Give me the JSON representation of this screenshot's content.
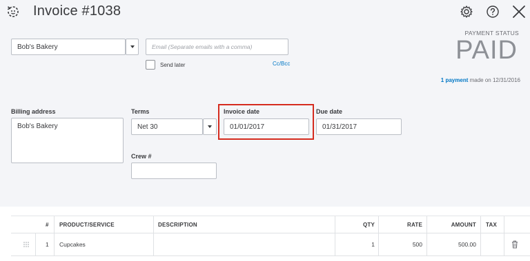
{
  "header": {
    "title": "Invoice #1038",
    "icons": [
      "history-icon",
      "gear-icon",
      "help-icon",
      "close-icon"
    ]
  },
  "payment_status": {
    "label": "PAYMENT STATUS",
    "value": "PAID",
    "payment_link": "1 payment",
    "payment_suffix": " made on 12/31/2016"
  },
  "customer": {
    "value": "Bob's Bakery"
  },
  "email": {
    "placeholder": "Email (Separate emails with a comma)",
    "send_later_label": "Send later",
    "send_later_checked": false,
    "cc_bcc": "Cc/Bcc"
  },
  "billing": {
    "label": "Billing address",
    "value": "Bob's Bakery"
  },
  "terms": {
    "label": "Terms",
    "value": "Net 30"
  },
  "invoice_date": {
    "label": "Invoice date",
    "value": "01/01/2017"
  },
  "due_date": {
    "label": "Due date",
    "value": "01/31/2017"
  },
  "crew": {
    "label": "Crew #",
    "value": ""
  },
  "table": {
    "headers": {
      "num": "#",
      "product": "PRODUCT/SERVICE",
      "description": "DESCRIPTION",
      "qty": "QTY",
      "rate": "RATE",
      "amount": "AMOUNT",
      "tax": "TAX"
    },
    "rows": [
      {
        "num": "1",
        "product": "Cupcakes",
        "description": "",
        "qty": "1",
        "rate": "500",
        "amount": "500.00",
        "tax": ""
      }
    ]
  },
  "colors": {
    "accent": "#0077c5",
    "highlight": "#d52b1e",
    "background": "#f4f5f8"
  }
}
